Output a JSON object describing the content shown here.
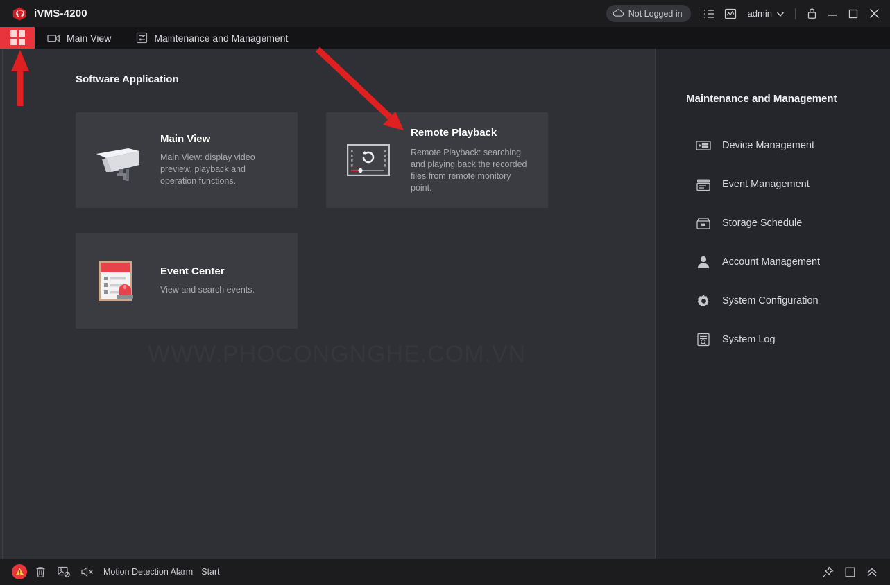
{
  "window": {
    "app_title": "iVMS-4200",
    "logo_icon": "hikvision-logo-icon",
    "login_status": "Not Logged in",
    "cloud_icon": "cloud-icon",
    "list_icon": "list-icon",
    "chart_icon": "chart-icon",
    "user_name": "admin",
    "caret_icon": "chevron-down-icon",
    "lock_icon": "lock-icon",
    "minimize_icon": "minimize-icon",
    "maximize_icon": "maximize-icon",
    "close_icon": "close-icon"
  },
  "tabbar": {
    "grid_icon": "grid-apps-icon",
    "tabs": [
      {
        "label": "Main View",
        "icon": "camera-video-icon"
      },
      {
        "label": "Maintenance and Management",
        "icon": "maintenance-icon"
      }
    ]
  },
  "main": {
    "section_title": "Software Application",
    "watermark": "WWW.PHOCONGNGHE.COM.VN",
    "cards": [
      {
        "title": "Main View",
        "desc": "Main View: display video preview, playback and operation functions.",
        "icon": "cctv-camera-icon"
      },
      {
        "title": "Remote Playback",
        "desc": "Remote Playback: searching and playing back the recorded files from remote monitory point.",
        "icon": "playback-screen-icon"
      },
      {
        "title": "Event Center",
        "desc": "View and search events.",
        "icon": "event-clipboard-icon"
      }
    ]
  },
  "right_panel": {
    "title": "Maintenance and Management",
    "items": [
      {
        "label": "Device Management",
        "icon": "device-icon"
      },
      {
        "label": "Event Management",
        "icon": "event-stack-icon"
      },
      {
        "label": "Storage Schedule",
        "icon": "storage-icon"
      },
      {
        "label": "Account Management",
        "icon": "user-account-icon"
      },
      {
        "label": "System Configuration",
        "icon": "gear-icon"
      },
      {
        "label": "System Log",
        "icon": "log-search-icon"
      }
    ]
  },
  "statusbar": {
    "alarm_icon": "alarm-warning-icon",
    "trash_icon": "trash-icon",
    "picture_off_icon": "picture-disabled-icon",
    "mute_icon": "speaker-mute-icon",
    "alarm_text": "Motion Detection Alarm",
    "alarm_action": "Start",
    "pin_icon": "pin-icon",
    "panel_icon": "panel-icon",
    "collapse_icon": "chevrons-up-icon"
  },
  "colors": {
    "accent_red": "#e8343c",
    "window_bg": "#2e3035",
    "card_bg": "#3a3c42",
    "panel_bg": "#25262b",
    "titlebar_bg": "#1c1c1f",
    "tabbar_bg": "#141417",
    "annotation_red": "#e02020"
  }
}
